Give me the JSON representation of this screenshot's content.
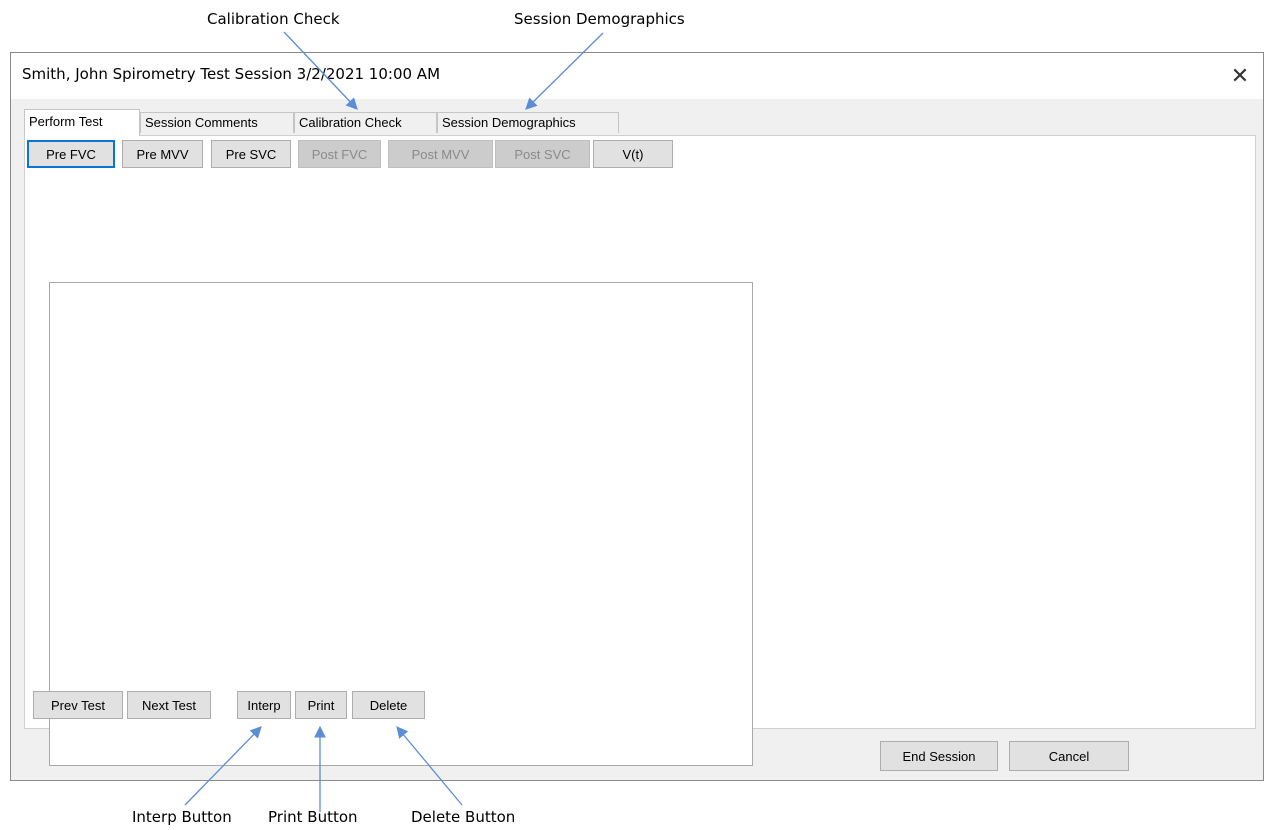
{
  "callouts": {
    "calibration_check": "Calibration Check",
    "session_demographics": "Session Demographics",
    "interp_button": "Interp Button",
    "print_button": "Print Button",
    "delete_button": "Delete Button"
  },
  "window": {
    "title": "Smith, John Spirometry Test Session 3/2/2021 10:00 AM",
    "close_glyph": "✕"
  },
  "tabs": [
    {
      "label": "Perform Test",
      "active": true
    },
    {
      "label": "Session Comments",
      "active": false
    },
    {
      "label": "Calibration Check",
      "active": false
    },
    {
      "label": "Session Demographics",
      "active": false
    }
  ],
  "test_buttons": [
    {
      "label": "Pre FVC",
      "enabled": true,
      "focused": true
    },
    {
      "label": "Pre MVV",
      "enabled": true
    },
    {
      "label": "Pre SVC",
      "enabled": true
    },
    {
      "label": "Post FVC",
      "enabled": false
    },
    {
      "label": "Post MVV",
      "enabled": false
    },
    {
      "label": "Post SVC",
      "enabled": false
    },
    {
      "label": "V(t)",
      "enabled": true
    }
  ],
  "nav_buttons": {
    "prev_test": "Prev Test",
    "next_test": "Next Test",
    "interp": "Interp",
    "print": "Print",
    "delete": "Delete"
  },
  "footer_buttons": {
    "end_session": "End Session",
    "cancel": "Cancel"
  },
  "colors": {
    "focus_border": "#0a74d7",
    "arrow": "#5b8ed6",
    "dialog_bg": "#f0f0f0"
  }
}
